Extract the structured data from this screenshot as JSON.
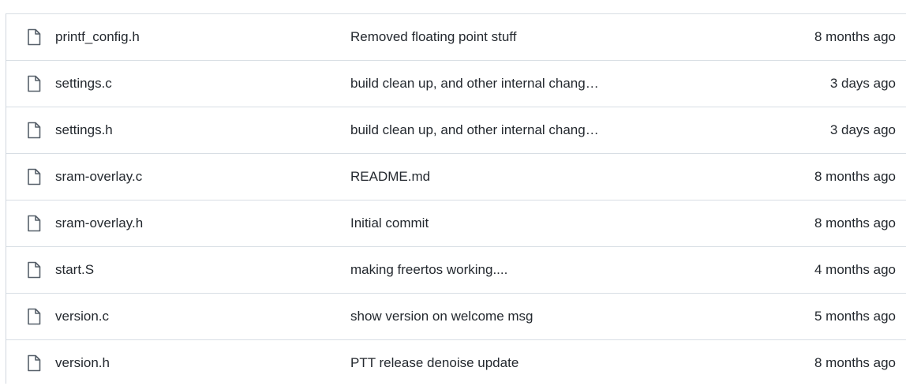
{
  "files": [
    {
      "name": "printf_config.h",
      "commit": "Removed floating point stuff",
      "age": "8 months ago"
    },
    {
      "name": "settings.c",
      "commit": "build clean up, and other internal chang…",
      "age": "3 days ago"
    },
    {
      "name": "settings.h",
      "commit": "build clean up, and other internal chang…",
      "age": "3 days ago"
    },
    {
      "name": "sram-overlay.c",
      "commit": "README.md",
      "age": "8 months ago"
    },
    {
      "name": "sram-overlay.h",
      "commit": "Initial commit",
      "age": "8 months ago"
    },
    {
      "name": "start.S",
      "commit": "making freertos working....",
      "age": "4 months ago"
    },
    {
      "name": "version.c",
      "commit": "show version on welcome msg",
      "age": "5 months ago"
    },
    {
      "name": "version.h",
      "commit": "PTT release denoise update",
      "age": "8 months ago"
    }
  ],
  "icons": {
    "file": "file-icon"
  },
  "colors": {
    "text": "#24292f",
    "icon": "#57606a",
    "border": "#d8dee4"
  }
}
